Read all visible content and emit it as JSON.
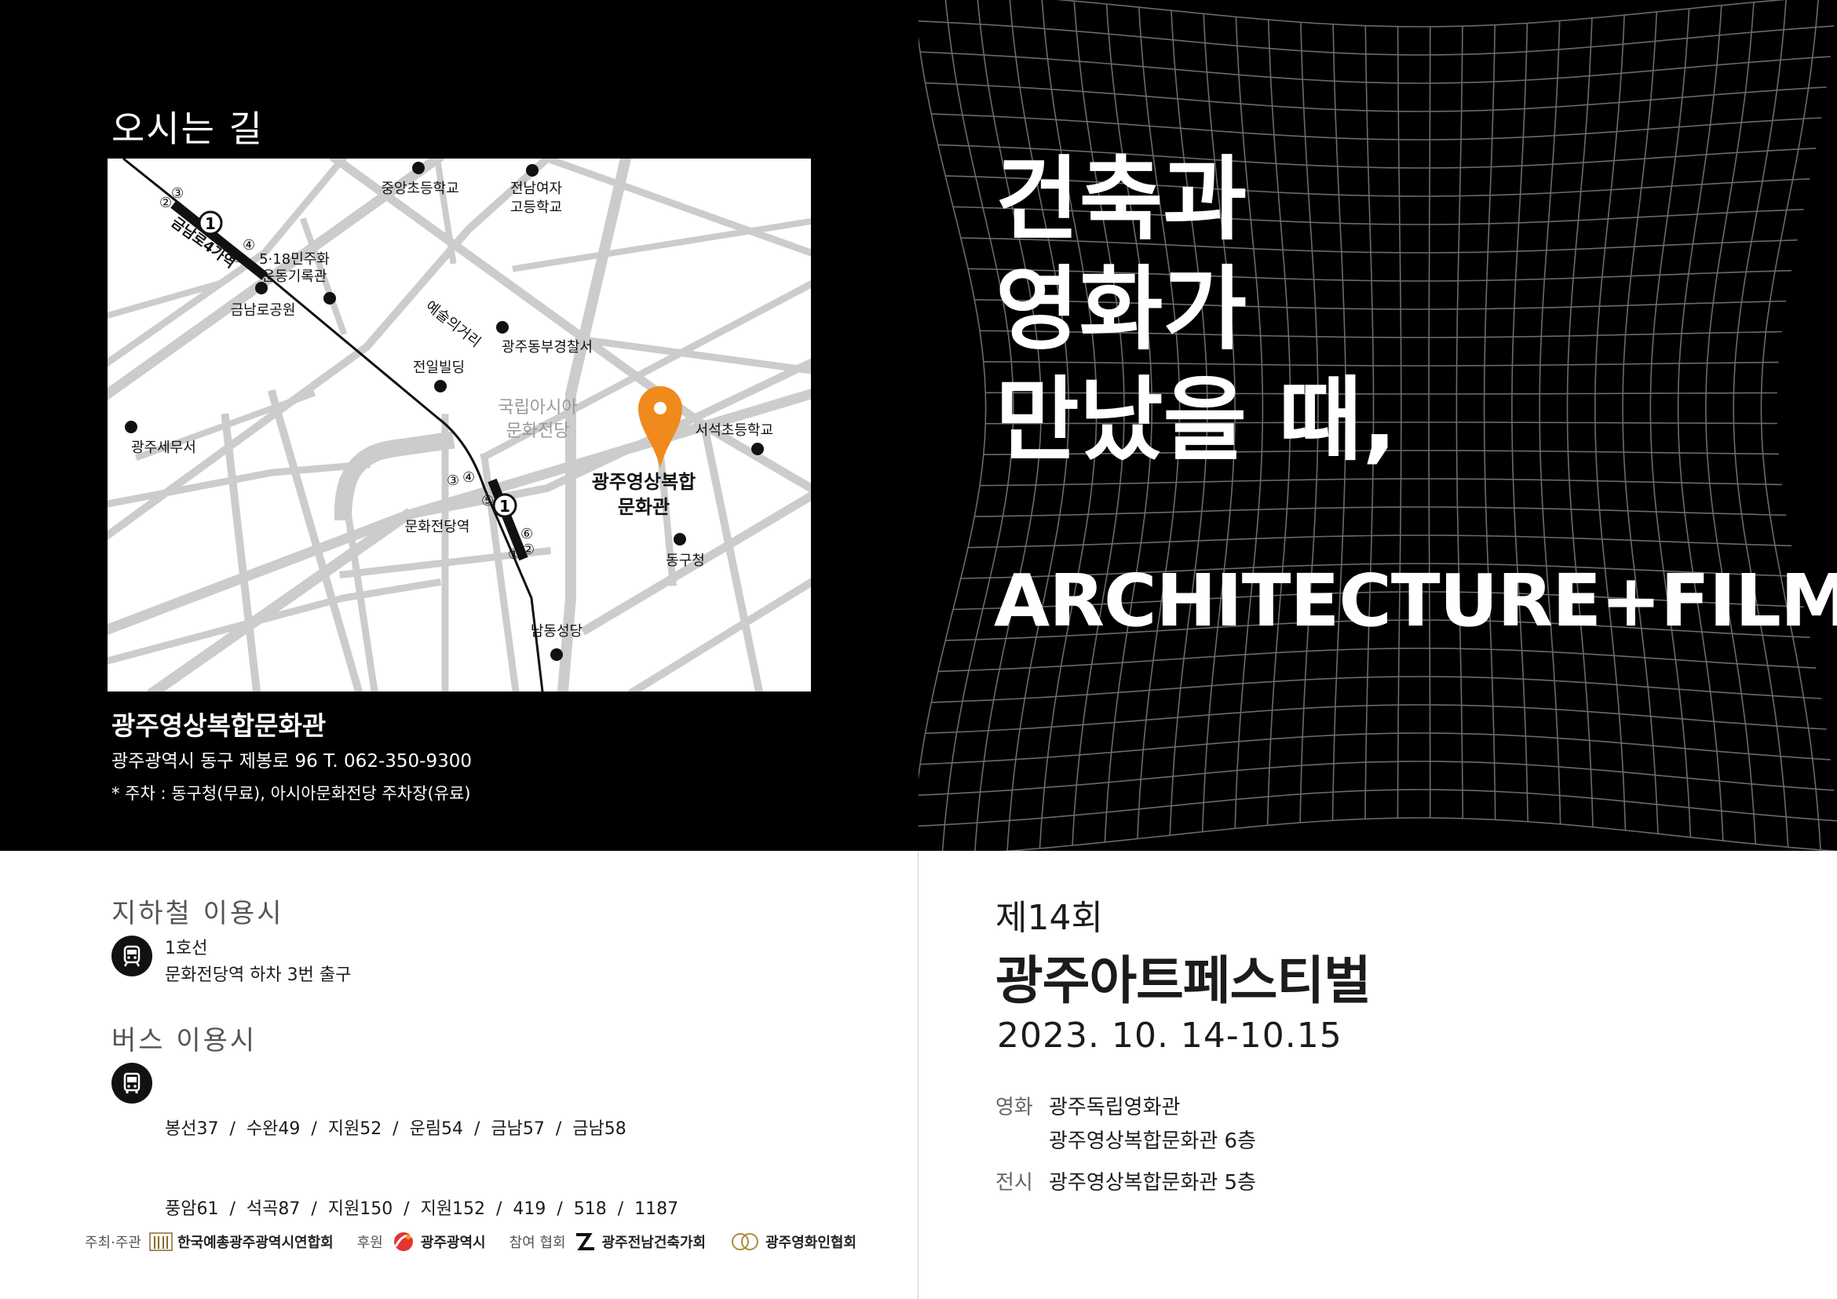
{
  "directions": {
    "title": "오시는 길",
    "map": {
      "labels": {
        "jungang_elem": "중앙초등학교",
        "jeonnam_girls_1": "전남여자",
        "jeonnam_girls_2": "고등학교",
        "memorial_1": "5·18민주화",
        "memorial_2": "운동기록관",
        "geumnamro_park": "금남로공원",
        "art_street": "예술의거리",
        "east_police": "광주동부경찰서",
        "jeonil_bldg": "전일빌딩",
        "acc_1": "국립아시아",
        "acc_2": "문화전당",
        "seoseok_elem": "서석초등학교",
        "tax_office": "광주세무서",
        "venue_1": "광주영상복합",
        "venue_2": "문화관",
        "donggu_office": "동구청",
        "station_munhwa": "문화전당역",
        "station_geumnamro": "금남로4가역",
        "namdong_church": "남동성당"
      },
      "line_badge": "1",
      "exits": [
        "①",
        "②",
        "③",
        "④",
        "⑤",
        "⑥"
      ],
      "road_color": "#cccccc",
      "pin_color": "#f08a1c"
    },
    "venue_name": "광주영상복합문화관",
    "venue_address": "광주광역시 동구 제봉로 96   T. 062-350-9300",
    "parking": "* 주차 : 동구청(무료), 아시아문화전당 주차장(유료)"
  },
  "headline": {
    "line1": "건축과",
    "line2": "영화가",
    "line3": "만났을 때,",
    "english": "ARCHITECTURE+FILM"
  },
  "subway": {
    "heading": "지하철 이용시",
    "icon": "subway-icon",
    "line1": "1호선",
    "line2": "문화전당역 하차 3번 출구"
  },
  "bus": {
    "heading": "버스 이용시",
    "icon": "bus-icon",
    "line1": "봉선37  /  수완49  /  지원52  /  운림54  /  금남57  /  금남58",
    "line2": "풍암61  /  석곡87  /  지원150  /  지원152  /  419  /  518  /  1187"
  },
  "festival": {
    "edition": "제14회",
    "name": "광주아트페스티벌",
    "dates": "2023. 10. 14-10.15",
    "venues": [
      {
        "label": "영화",
        "line1": "광주독립영화관",
        "line2": "광주영상복합문화관 6층"
      },
      {
        "label": "전시",
        "line1": "광주영상복합문화관 5층",
        "line2": ""
      }
    ]
  },
  "footer": {
    "host_label": "주최·주관",
    "host": "한국예총광주광역시연합회",
    "sponsor_label": "후원",
    "sponsor": "광주광역시",
    "partner_label": "참여 협회",
    "partner1": "광주전남건축가회",
    "partner2": "광주영화인협회"
  },
  "colors": {
    "background": "#000000",
    "accent": "#f08a1c",
    "grid": "#777777"
  }
}
